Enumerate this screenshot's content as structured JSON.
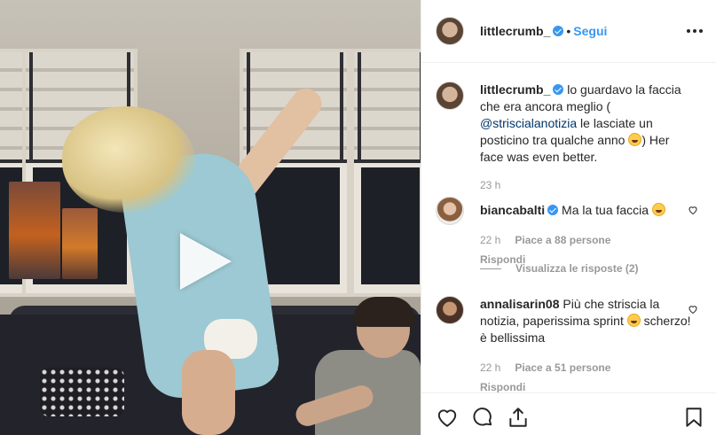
{
  "post": {
    "author": "littlecrumb_",
    "follow_label": "Segui",
    "separator": "•",
    "verified": true
  },
  "caption": {
    "username": "littlecrumb_",
    "text_before": "lo guardavo la faccia che era ancora meglio (",
    "mention": "@striscialanotizia",
    "text_after": "le lasciate un posticino tra qualche anno",
    "text_end": ") Her face was even better.",
    "time": "23 h"
  },
  "comments": [
    {
      "username": "biancabalti",
      "verified": true,
      "text": "Ma la tua faccia",
      "time": "22 h",
      "likes": "Piace a 88 persone",
      "reply": "Rispondi",
      "view_replies": "Visualizza le risposte (2)"
    },
    {
      "username": "annalisarin08",
      "verified": false,
      "text": "Più che striscia la notizia, paperissima sprint",
      "text_end": "scherzo! è bellissima",
      "time": "22 h",
      "likes": "Piace a 51 persone",
      "reply": "Rispondi"
    }
  ],
  "icons": {
    "like": "heart-icon",
    "comment": "comment-icon",
    "share": "share-icon",
    "save": "bookmark-icon",
    "more": "more-icon",
    "play": "play-icon",
    "emoji": "emoji-icon"
  },
  "colors": {
    "accent": "#3897f0",
    "text": "#262626",
    "muted": "#999999",
    "border": "#efefef"
  }
}
